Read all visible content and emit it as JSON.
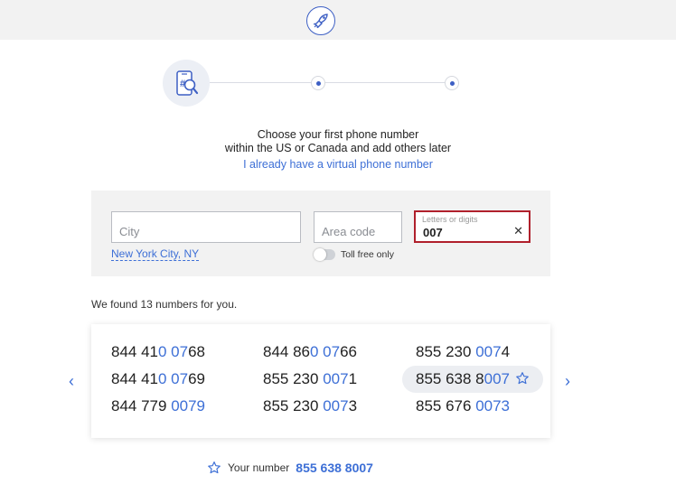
{
  "header": {
    "logo_icon": "rocket-logo-icon"
  },
  "stepper": {
    "step1_icon": "phone-search-icon",
    "steps": 3
  },
  "headline": {
    "line1": "Choose your first phone number",
    "line2": "within the US or Canada and add others later",
    "virtual_link": "I already have a virtual phone number"
  },
  "search": {
    "city_placeholder": "City",
    "area_placeholder": "Area code",
    "letters_label": "Letters or digits",
    "letters_value": "007",
    "clear_icon": "close-icon",
    "city_link": "New York City, NY",
    "toll_free_label": "Toll free only",
    "toll_free_on": false
  },
  "results": {
    "found_text": "We found 13 numbers for you.",
    "numbers": [
      {
        "pre": "844 41",
        "match": "0 07",
        "post": "68",
        "selected": false
      },
      {
        "pre": "844 86",
        "match": "0 07",
        "post": "66",
        "selected": false
      },
      {
        "pre": "855 230 ",
        "match": "007",
        "post": "4",
        "selected": false
      },
      {
        "pre": "844 41",
        "match": "0 07",
        "post": "69",
        "selected": false
      },
      {
        "pre": "855 230 ",
        "match": "007",
        "post": "1",
        "selected": false
      },
      {
        "pre": "855 638 8",
        "match": "007",
        "post": "",
        "selected": true
      },
      {
        "pre": "844 779 ",
        "match": "0079",
        "post": "",
        "selected": false
      },
      {
        "pre": "855 230 ",
        "match": "007",
        "post": "3",
        "selected": false
      },
      {
        "pre": "855 676 ",
        "match": "0073",
        "post": "",
        "selected": false
      }
    ],
    "prev_label": "‹",
    "next_label": "›"
  },
  "your_number": {
    "label": "Your number",
    "value": "855 638 8007",
    "icon": "star-icon"
  },
  "colors": {
    "accent": "#3d6fd6",
    "error_border": "#b0202c",
    "panel_bg": "#f2f2f2"
  }
}
